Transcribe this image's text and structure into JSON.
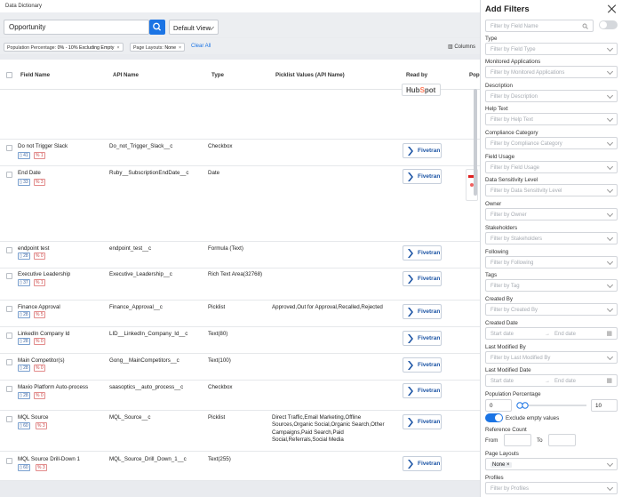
{
  "app": {
    "title": "Data Dictionary"
  },
  "search": {
    "value": "Opportunity",
    "view": "Default View"
  },
  "chips": [
    {
      "label": "Population Percentage:",
      "value": "0% - 10% Excluding Empty"
    },
    {
      "label": "Page Layouts:",
      "value": "None"
    }
  ],
  "toolbar": {
    "clear_all": "Clear All",
    "columns": "Columns"
  },
  "table": {
    "headers": {
      "field_name": "Field Name",
      "api_name": "API Name",
      "type": "Type",
      "picklist": "Picklist Values (API Name)",
      "read_by": "Read by",
      "pop": "Pop"
    },
    "hubspot_label": "HubSpot",
    "rows": [
      {
        "name": "Do not Trigger Slack",
        "api": "Do_not_Trigger_Slack__c",
        "type": "Checkbox",
        "picklist": "",
        "count": "41",
        "pct": "1",
        "read_by": "Fivetran"
      },
      {
        "name": "End Date",
        "api": "Ruby__SubscriptionEndDate__c",
        "type": "Date",
        "picklist": "",
        "count": "33",
        "pct": "3",
        "read_by": "Fivetran"
      },
      {
        "name": "endpoint test",
        "api": "endpoint_test__c",
        "type": "Formula (Text)",
        "picklist": "",
        "count": "28",
        "pct": "0",
        "read_by": "Fivetran"
      },
      {
        "name": "Executive Leadership",
        "api": "Executive_Leadership__c",
        "type": "Rich Text Area(32768)",
        "picklist": "",
        "count": "37",
        "pct": "1",
        "read_by": "Fivetran"
      },
      {
        "name": "Finance Approval",
        "api": "Finance_Approval__c",
        "type": "Picklist",
        "picklist": "Approved,Out for Approval,Recalled,Rejected",
        "count": "28",
        "pct": "5",
        "read_by": "Fivetran"
      },
      {
        "name": "LinkedIn Company Id",
        "api": "LID__LinkedIn_Company_Id__c",
        "type": "Text(80)",
        "picklist": "",
        "count": "28",
        "pct": "0",
        "read_by": "Fivetran"
      },
      {
        "name": "Main Competitor(s)",
        "api": "Gong__MainCompetitors__c",
        "type": "Text(100)",
        "picklist": "",
        "count": "28",
        "pct": "0",
        "read_by": "Fivetran"
      },
      {
        "name": "Maxio Platform Auto-process",
        "api": "saasoptics__auto_process__c",
        "type": "Checkbox",
        "picklist": "",
        "count": "28",
        "pct": "0",
        "read_by": "Fivetran"
      },
      {
        "name": "MQL Source",
        "api": "MQL_Source__c",
        "type": "Picklist",
        "picklist": "Direct Traffic,Email Marketing,Offline Sources,Organic Social,Organic Search,Other Campaigns,Paid Search,Paid Social,Referrals,Social Media",
        "count": "60",
        "pct": "3",
        "read_by": "Fivetran"
      },
      {
        "name": "MQL Source Drill-Down 1",
        "api": "MQL_Source_Drill_Down_1__c",
        "type": "Text(255)",
        "picklist": "",
        "count": "60",
        "pct": "3",
        "read_by": "Fivetran"
      }
    ]
  },
  "filters": {
    "title": "Add Filters",
    "field_name_placeholder": "Filter by Field Name",
    "items": [
      {
        "label": "Type",
        "placeholder": "Filter by Field Type"
      },
      {
        "label": "Monitored Applications",
        "placeholder": "Filter by Monitored Applications"
      },
      {
        "label": "Description",
        "placeholder": "Filter by Description"
      },
      {
        "label": "Help Text",
        "placeholder": "Filter by Help Text"
      },
      {
        "label": "Compliance Category",
        "placeholder": "Filter by Compliance Category"
      },
      {
        "label": "Field Usage",
        "placeholder": "Filter by Field Usage"
      },
      {
        "label": "Data Sensitivity Level",
        "placeholder": "Filter by Data Sensitivity Level"
      },
      {
        "label": "Owner",
        "placeholder": "Filter by Owner"
      },
      {
        "label": "Stakeholders",
        "placeholder": "Filter by Stakeholders"
      },
      {
        "label": "Following",
        "placeholder": "Filter by Following"
      },
      {
        "label": "Tags",
        "placeholder": "Filter by Tag"
      },
      {
        "label": "Created By",
        "placeholder": "Filter by Created By"
      }
    ],
    "created_date": {
      "label": "Created Date",
      "start": "Start date",
      "end": "End date"
    },
    "last_modified_by": {
      "label": "Last Modified By",
      "placeholder": "Filter by Last Modified By"
    },
    "last_modified_date": {
      "label": "Last Modified Date",
      "start": "Start date",
      "end": "End date"
    },
    "population": {
      "label": "Population Percentage",
      "min": "0",
      "max": "10",
      "exclude_label": "Exclude empty values"
    },
    "reference_count": {
      "label": "Reference Count",
      "from": "From",
      "to": "To"
    },
    "page_layouts": {
      "label": "Page Layouts",
      "value": "None"
    },
    "profiles": {
      "label": "Profiles",
      "placeholder": "Filter by Profiles"
    }
  }
}
